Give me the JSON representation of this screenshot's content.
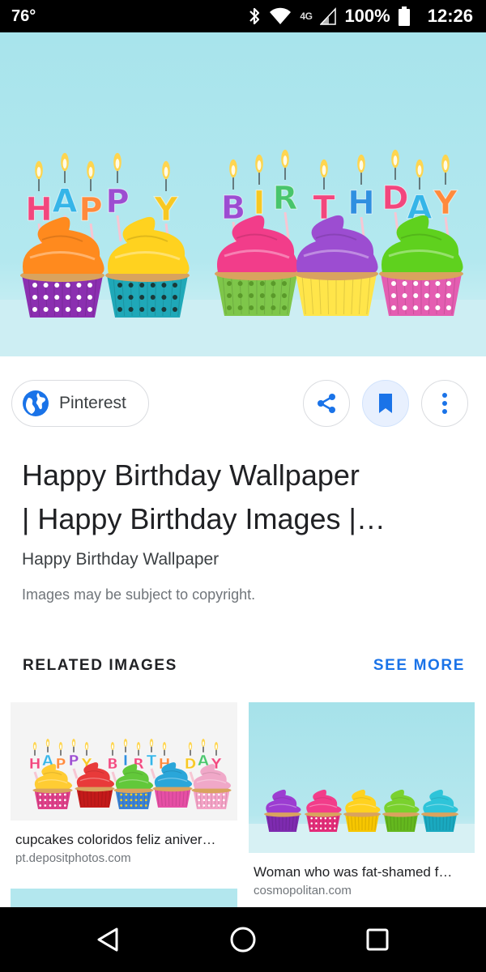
{
  "status_bar": {
    "temperature": "76°",
    "network": "4G",
    "battery": "100%",
    "time": "12:26"
  },
  "hero": {
    "letters_left": [
      "H",
      "A",
      "P",
      "P",
      "Y"
    ],
    "letters_right": [
      "B",
      "I",
      "R",
      "T",
      "H",
      "D",
      "A",
      "Y"
    ],
    "icons": [
      "bluetooth-icon",
      "wifi-icon",
      "signal-icon",
      "battery-icon"
    ]
  },
  "source": {
    "name": "Pinterest",
    "icon": "globe-icon"
  },
  "actions": [
    {
      "name": "share",
      "icon": "share-icon"
    },
    {
      "name": "save",
      "icon": "bookmark-icon"
    },
    {
      "name": "more",
      "icon": "more-vert-icon"
    }
  ],
  "result": {
    "title_line1": "Happy Birthday Wallpaper",
    "title_line2": "| Happy Birthday Images |…",
    "subtitle": "Happy Birthday Wallpaper",
    "copyright": "Images may be subject to copyright."
  },
  "related": {
    "heading": "RELATED IMAGES",
    "see_more": "SEE MORE",
    "items": [
      {
        "caption": "cupcakes coloridos feliz aniver…",
        "source": "pt.depositphotos.com"
      },
      {
        "caption": "Woman who was fat-shamed f…",
        "source": "cosmopolitan.com"
      }
    ]
  },
  "colors": {
    "accent": "#1a73e8",
    "hero_bg": "#b3e8ef"
  }
}
